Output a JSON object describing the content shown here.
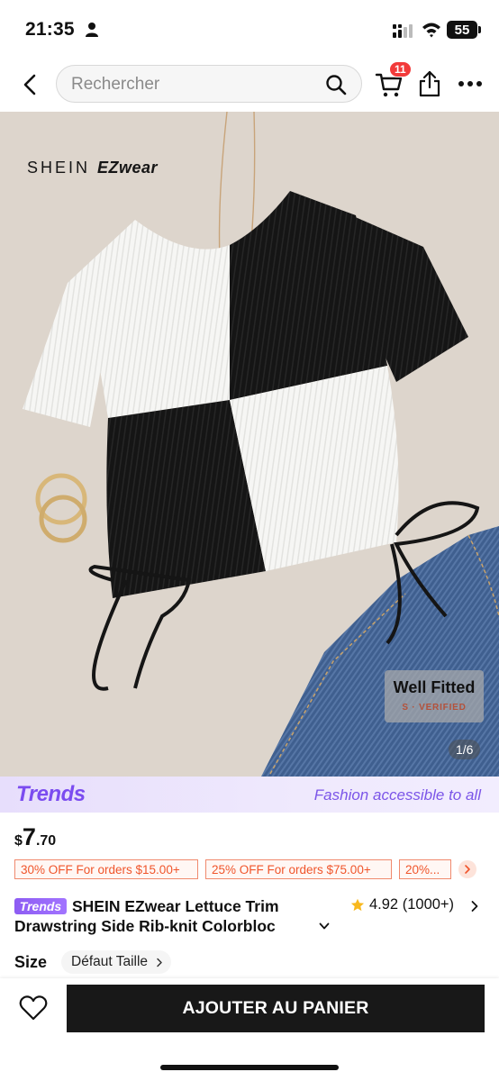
{
  "status_bar": {
    "time": "21:35",
    "battery": "55"
  },
  "search": {
    "placeholder": "Rechercher"
  },
  "cart": {
    "badge_count": "11"
  },
  "product_image": {
    "brand_logo_prefix": "SHEIN",
    "brand_logo_name": "EZwear",
    "badge_title": "Well Fitted",
    "badge_subtitle": "S · VERIFIED",
    "counter": "1/6",
    "colors": {
      "black": "#151515",
      "white": "#f4f4f2",
      "background": "#ddd5cc",
      "denim": "#3c5a8a"
    }
  },
  "trends": {
    "logo": "Trends",
    "tagline": "Fashion accessible to all",
    "tag": "Trends",
    "accent": "#7b4cf0"
  },
  "price": {
    "currency": "$",
    "integer": "7",
    "decimal": ".70"
  },
  "coupons": [
    {
      "label": "30% OFF For orders $15.00+"
    },
    {
      "label": "25% OFF For orders $75.00+"
    },
    {
      "label": "20%..."
    }
  ],
  "product": {
    "title_line1": "SHEIN EZwear Lettuce Trim",
    "title_line2": "Drawstring Side Rib-knit Colorbloc",
    "rating": "4.92",
    "review_count": "(1000+)"
  },
  "size": {
    "label": "Size",
    "value": "Défaut Taille"
  },
  "actions": {
    "add_to_cart": "AJOUTER AU PANIER"
  },
  "icons": [
    "person-icon",
    "signal-icon",
    "wifi-icon",
    "back-icon",
    "search-icon",
    "cart-icon",
    "share-icon",
    "more-icon",
    "star-icon",
    "chevron-right-icon",
    "chevron-down-icon",
    "heart-icon"
  ]
}
